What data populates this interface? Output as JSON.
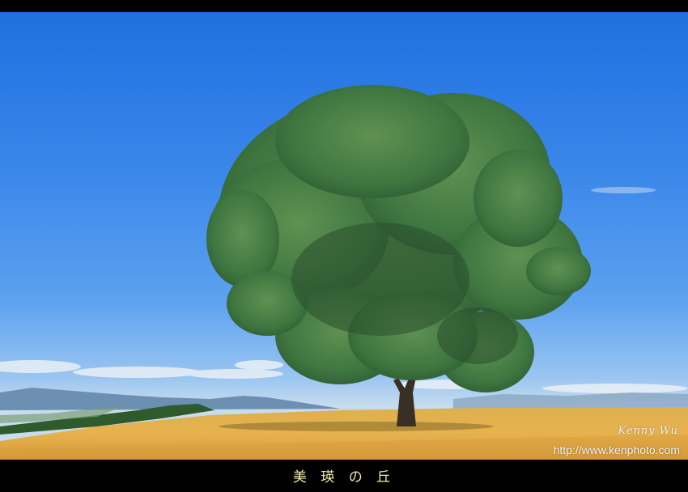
{
  "photo": {
    "subject": "lone-tree-on-hill",
    "signature": "Kenny Wu",
    "url": "http://www.kenphoto.com"
  },
  "caption": "美 瑛 の 丘",
  "colors": {
    "sky_top": "#1f6fe0",
    "sky_bottom": "#c7dcee",
    "field": "#e6b24a",
    "foliage": "#3f7a3a",
    "caption_text": "#f3e9b0",
    "frame": "#000000"
  }
}
